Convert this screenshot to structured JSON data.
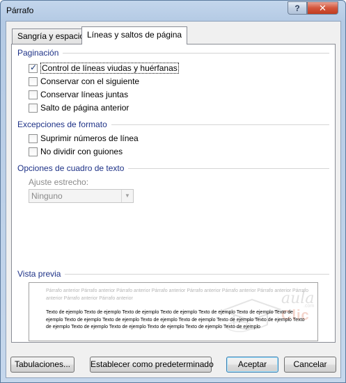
{
  "window": {
    "title": "Párrafo"
  },
  "titlebar": {
    "help_label": "?",
    "close_label": "✕"
  },
  "tabs": [
    {
      "label": "Sangría y espacio",
      "active": false
    },
    {
      "label": "Líneas y saltos de página",
      "active": true
    }
  ],
  "sections": {
    "paginacion": "Paginación",
    "excepciones": "Excepciones de formato",
    "opciones_cuadro": "Opciones de cuadro de texto",
    "vista_previa": "Vista previa"
  },
  "paginacion_items": [
    {
      "label": "Control de líneas viudas y huérfanas",
      "checked": true
    },
    {
      "label": "Conservar con el siguiente",
      "checked": false
    },
    {
      "label": "Conservar líneas juntas",
      "checked": false
    },
    {
      "label": "Salto de página anterior",
      "checked": false
    }
  ],
  "excepciones_items": [
    {
      "label": "Suprimir números de línea",
      "checked": false
    },
    {
      "label": "No dividir con guiones",
      "checked": false
    }
  ],
  "ajuste": {
    "label": "Ajuste estrecho:",
    "value": "Ninguno"
  },
  "preview": {
    "previous_text": "Párrafo anterior Párrafo anterior Párrafo anterior Párrafo anterior Párrafo anterior Párrafo anterior Párrafo anterior Párrafo anterior Párrafo anterior Párrafo anterior",
    "sample_text": "Texto de ejemplo Texto de ejemplo Texto de ejemplo Texto de ejemplo Texto de ejemplo Texto de ejemplo Texto de ejemplo Texto de ejemplo Texto de ejemplo Texto de ejemplo Texto de ejemplo Texto de ejemplo Texto de ejemplo Texto de ejemplo Texto de ejemplo Texto de ejemplo Texto de ejemplo Texto de ejemplo Texto de ejemplo"
  },
  "watermark": {
    "aula": "aula",
    "com": ".com",
    "clic": "Clic"
  },
  "buttons": {
    "tabulaciones": "Tabulaciones...",
    "establecer": "Establecer como predeterminado",
    "aceptar": "Aceptar",
    "cancelar": "Cancelar"
  },
  "colors": {
    "section_heading": "#1e3287",
    "titlebar": "#b4cae4",
    "close_button": "#c13d20"
  }
}
